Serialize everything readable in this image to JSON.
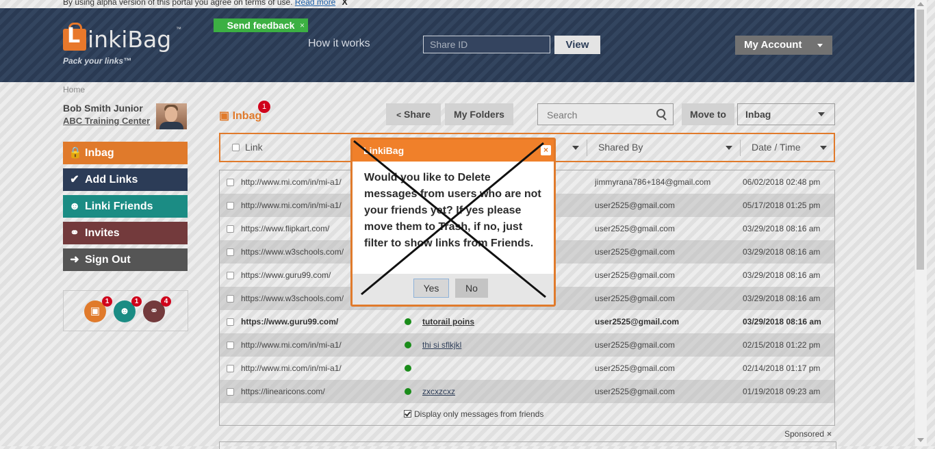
{
  "notice": {
    "text": "By using alpha version of this portal you agree on terms of use.",
    "link": "Read more",
    "close": "X"
  },
  "header": {
    "logo_letter": "L",
    "logo_name": "inkiBag",
    "logo_tm": "™",
    "logo_tagline": "Pack your links™",
    "feedback_label": "Send feedback",
    "feedback_close": "×",
    "how_it_works": "How it works",
    "share_id_placeholder": "Share ID",
    "view_label": "View",
    "account_label": "My Account"
  },
  "breadcrumb": "Home",
  "user": {
    "name": "Bob Smith Junior",
    "org": "ABC Training Center"
  },
  "nav": [
    {
      "label": "Inbag",
      "icon": "bag-icon"
    },
    {
      "label": "Add Links",
      "icon": "check-icon"
    },
    {
      "label": "Linki Friends",
      "icon": "users-icon"
    },
    {
      "label": "Invites",
      "icon": "link-icon"
    },
    {
      "label": "Sign Out",
      "icon": "sign-out-icon"
    }
  ],
  "badges": {
    "inbag": "1",
    "friends": "1",
    "invites": "4"
  },
  "toolbar": {
    "inbag_title": "Inbag",
    "inbag_count": "1",
    "share_label": "Share",
    "folders_label": "My Folders",
    "search_placeholder": "Search",
    "move_to_label": "Move to",
    "move_to_value": "Inbag"
  },
  "columns": {
    "link": "Link",
    "shared_by": "Shared By",
    "date_time": "Date / Time"
  },
  "rows": [
    {
      "link": "http://www.mi.com/in/mi-a1/",
      "title": "",
      "shared_by": "jimmyrana786+184@gmail.com",
      "date": "06/02/2018 02:48 pm"
    },
    {
      "link": "http://www.mi.com/in/mi-a1/",
      "title": "",
      "shared_by": "user2525@gmail.com",
      "date": "05/17/2018 01:25 pm"
    },
    {
      "link": "https://www.flipkart.com/",
      "title": "",
      "shared_by": "user2525@gmail.com",
      "date": "03/29/2018 08:16 am"
    },
    {
      "link": "https://www.w3schools.com/",
      "title": "",
      "shared_by": "user2525@gmail.com",
      "date": "03/29/2018 08:16 am"
    },
    {
      "link": "https://www.guru99.com/",
      "title": "",
      "shared_by": "user2525@gmail.com",
      "date": "03/29/2018 08:16 am"
    },
    {
      "link": "https://www.w3schools.com/",
      "title": "",
      "shared_by": "user2525@gmail.com",
      "date": "03/29/2018 08:16 am"
    },
    {
      "link": "https://www.guru99.com/",
      "title": "tutorail poins",
      "shared_by": "user2525@gmail.com",
      "date": "03/29/2018 08:16 am"
    },
    {
      "link": "http://www.mi.com/in/mi-a1/",
      "title": "thi si sflkjkl",
      "shared_by": "user2525@gmail.com",
      "date": "02/15/2018 01:22 pm"
    },
    {
      "link": "http://www.mi.com/in/mi-a1/",
      "title": "",
      "shared_by": "user2525@gmail.com",
      "date": "02/14/2018 01:17 pm"
    },
    {
      "link": "https://linearicons.com/",
      "title": "zxcxzcxz",
      "shared_by": "user2525@gmail.com",
      "date": "01/19/2018 09:23 am"
    }
  ],
  "friends_only_label": "Display only messages from friends",
  "sponsored": {
    "label": "Sponsored",
    "close": "×"
  },
  "modal": {
    "title": "LinkiBag",
    "close": "×",
    "message": "Would you like to Delete messages from users who are not your friends yet? If yes please move them to Trash, if no, just filter to show links from Friends.",
    "yes_label": "Yes",
    "no_label": "No"
  },
  "colors": {
    "accent": "#e07a2b",
    "navy": "#2c3c57",
    "teal": "#1b8c84",
    "maroon": "#733a3c",
    "green": "#3cb043",
    "badge": "#d0021b"
  }
}
